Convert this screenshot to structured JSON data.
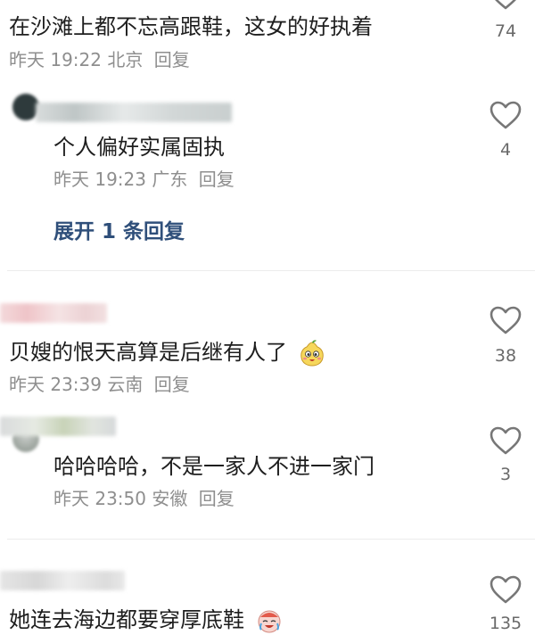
{
  "comments": [
    {
      "text": "在沙滩上都不忘高跟鞋，这女的好执着",
      "time": "昨天 19:22",
      "location": "北京",
      "reply_label": "回复",
      "likes": "74"
    },
    {
      "text": "个人偏好实属固执",
      "time": "昨天 19:23",
      "location": "广东",
      "reply_label": "回复",
      "likes": "4",
      "expand_label": "展开 1 条回复"
    },
    {
      "text": "贝嫂的恨天高算是后继有人了",
      "time": "昨天 23:39",
      "location": "云南",
      "reply_label": "回复",
      "likes": "38"
    },
    {
      "text": "哈哈哈哈，不是一家人不进一家门",
      "time": "昨天 23:50",
      "location": "安徽",
      "reply_label": "回复",
      "likes": "3"
    },
    {
      "text": "她连去海边都要穿厚底鞋",
      "likes": "135"
    }
  ],
  "icons": {
    "like": "heart-outline-icon",
    "emoji_1": "pear-smile-emoji-icon",
    "emoji_2": "crying-laughing-emoji-icon"
  },
  "colors": {
    "text": "#1e1e1e",
    "meta": "#8e8e8e",
    "expand_link": "#2f4f7a",
    "heart_stroke": "#777777",
    "divider": "#ececec"
  }
}
